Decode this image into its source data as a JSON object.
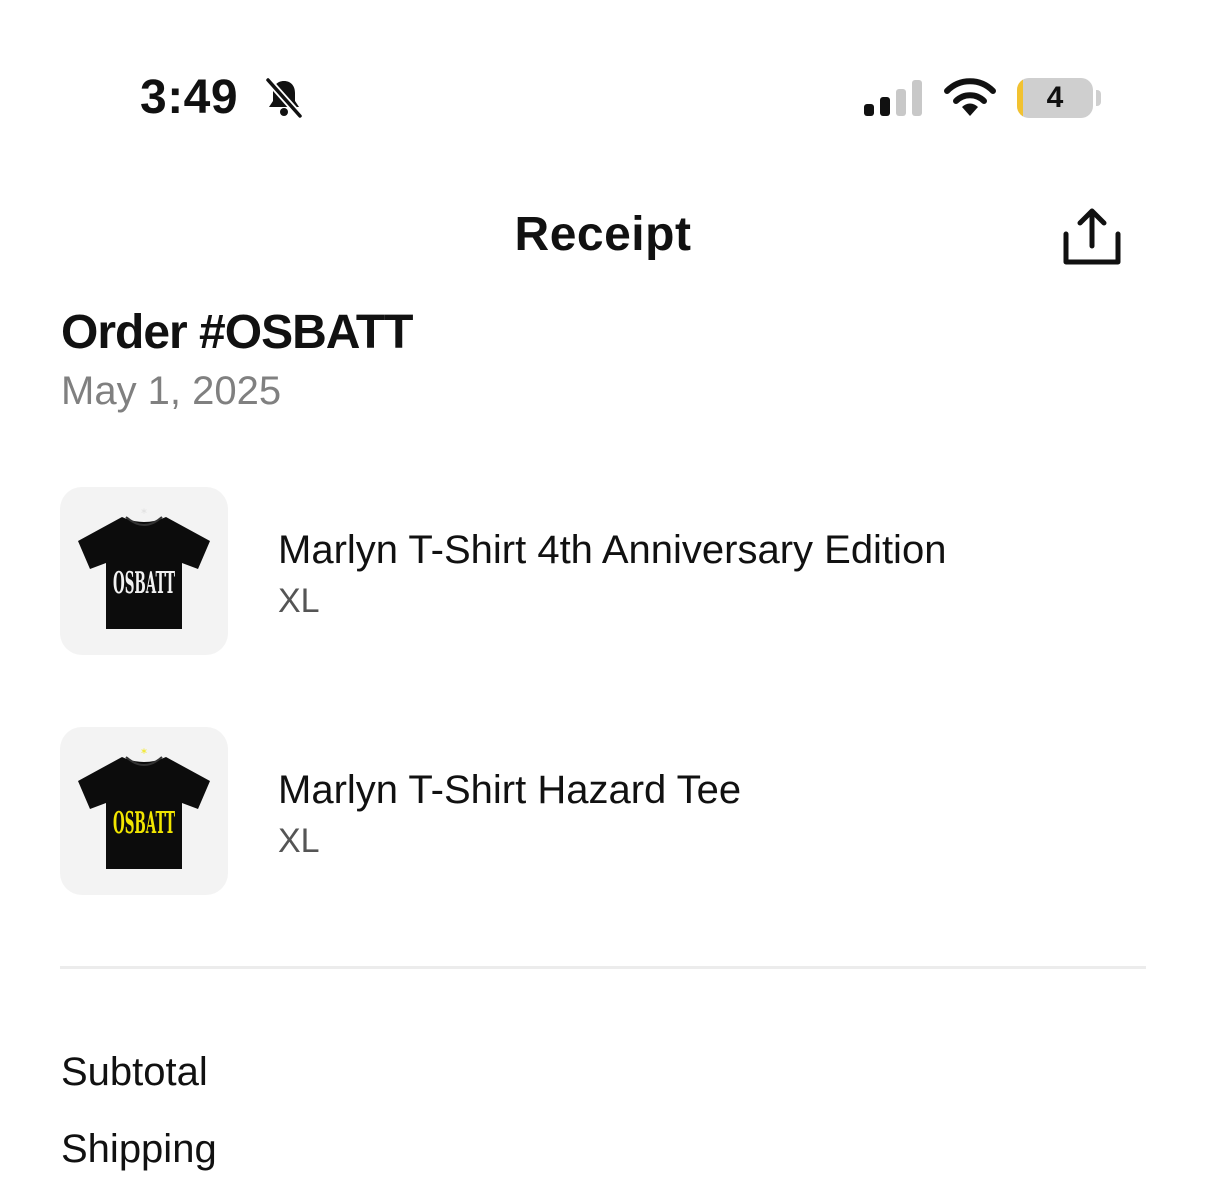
{
  "status_bar": {
    "time": "3:49",
    "battery_level": "4",
    "battery_fraction": 0.04,
    "icons": [
      "bell-slash-icon",
      "cellular-signal-icon",
      "wifi-icon",
      "battery-icon"
    ]
  },
  "header": {
    "title": "Receipt",
    "share_icon": "share-icon"
  },
  "order": {
    "title": "Order #OSBATT",
    "date": "May 1, 2025"
  },
  "items": [
    {
      "name": "Marlyn T-Shirt 4th Anniversary Edition",
      "variant": "XL",
      "logo": "OSBATT",
      "logo_color": "#f2f2f2"
    },
    {
      "name": "Marlyn T-Shirt Hazard Tee",
      "variant": "XL",
      "logo": "OSBATT",
      "logo_color": "#f2e600"
    }
  ],
  "summary": {
    "subtotal_label": "Subtotal",
    "shipping_label": "Shipping"
  },
  "colors": {
    "background": "#ffffff",
    "text": "#111111",
    "muted": "#808080",
    "battery_low": "#f2c230"
  }
}
